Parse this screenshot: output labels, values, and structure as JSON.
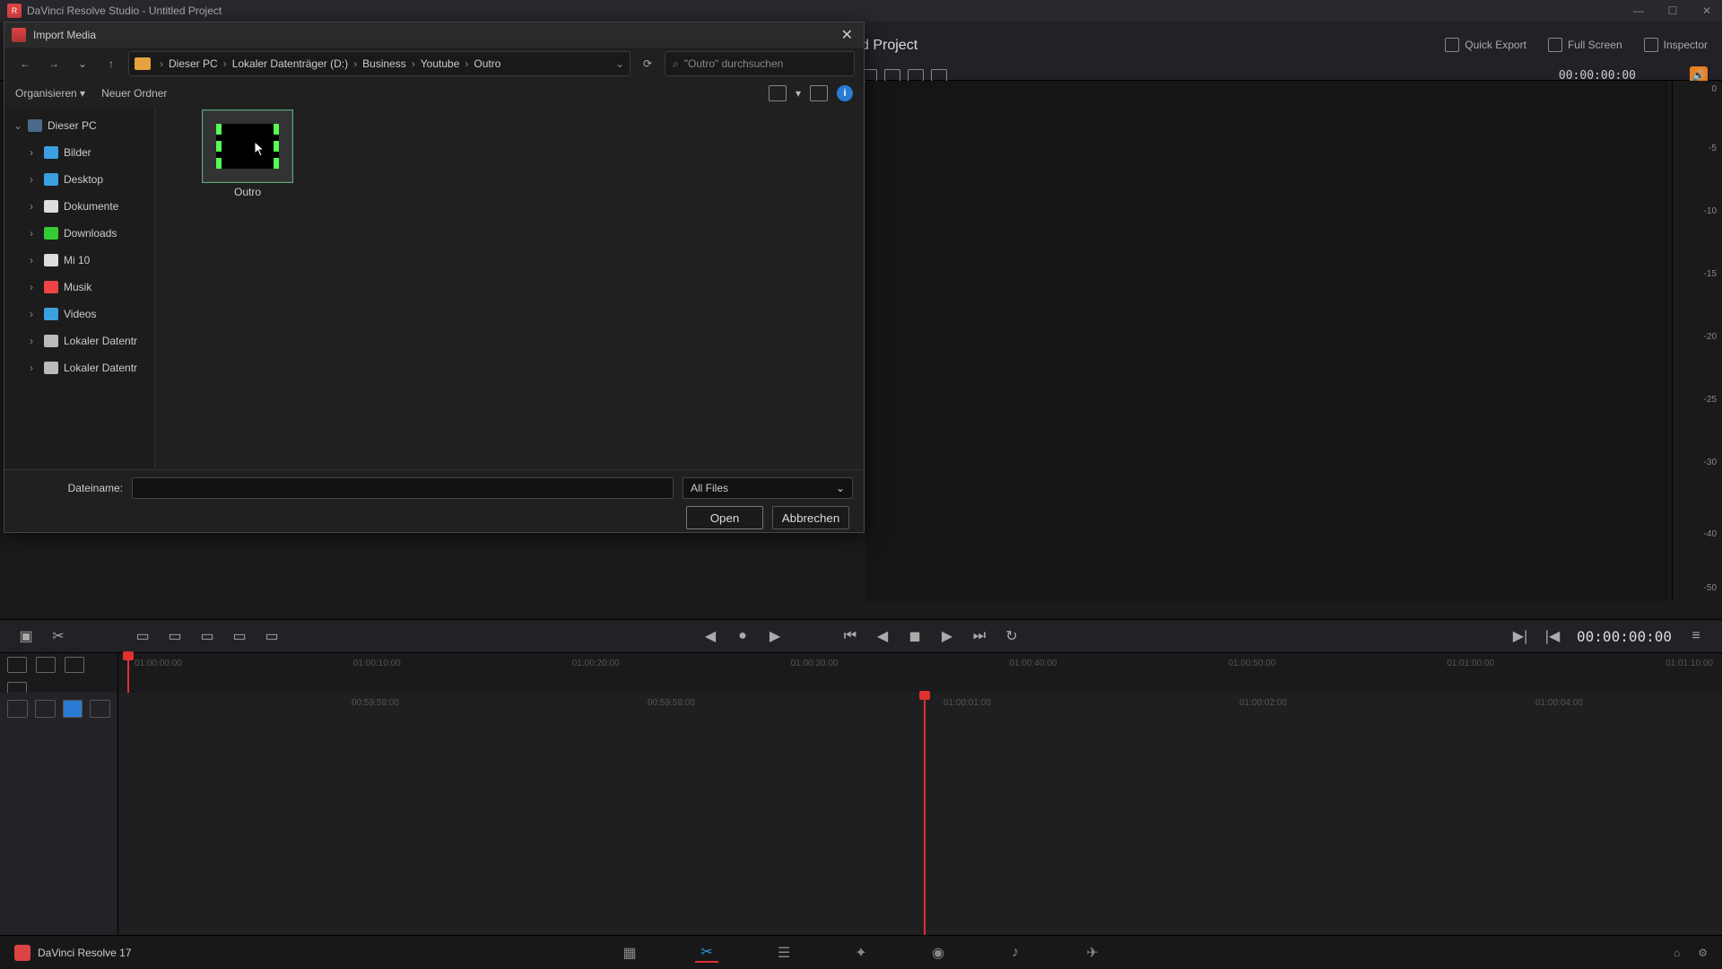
{
  "app": {
    "title": "DaVinci Resolve Studio - Untitled Project",
    "footer_name": "DaVinci Resolve 17"
  },
  "header": {
    "project_title": "d Project",
    "quick_export": "Quick Export",
    "full_screen": "Full Screen",
    "inspector": "Inspector",
    "timecode": "00:00:00:00"
  },
  "meters": {
    "m0": "0",
    "m5": "-5",
    "m10": "-10",
    "m15": "-15",
    "m20": "-20",
    "m25": "-25",
    "m30": "-30",
    "m40": "-40",
    "m50": "-50"
  },
  "transport": {
    "timecode": "00:00:00:00"
  },
  "ruler1_ticks": [
    "01:00:00:00",
    "01:00:10:00",
    "01:00:20:00",
    "01:00:30:00",
    "01:00:40:00",
    "01:00:50:00",
    "01:01:00:00",
    "01:01:10:00"
  ],
  "ruler2_ticks": [
    {
      "pos": 260,
      "label": "00:59:59:00"
    },
    {
      "pos": 590,
      "label": "00:59:59:00"
    },
    {
      "pos": 920,
      "label": "01:00:01:00"
    },
    {
      "pos": 1250,
      "label": "01:00:02:00"
    },
    {
      "pos": 1580,
      "label": "01:00:04:00"
    }
  ],
  "dialog": {
    "title": "Import Media",
    "organize": "Organisieren",
    "newfolder": "Neuer Ordner",
    "search_placeholder": "\"Outro\" durchsuchen",
    "path": [
      "Dieser PC",
      "Lokaler Datenträger (D:)",
      "Business",
      "Youtube",
      "Outro"
    ],
    "tree": [
      {
        "label": "Dieser PC",
        "cls": "ic-pc",
        "root": true
      },
      {
        "label": "Bilder",
        "cls": "ic-blue"
      },
      {
        "label": "Desktop",
        "cls": "ic-blue"
      },
      {
        "label": "Dokumente",
        "cls": "ic-doc"
      },
      {
        "label": "Downloads",
        "cls": "ic-dl"
      },
      {
        "label": "Mi 10",
        "cls": "ic-phone"
      },
      {
        "label": "Musik",
        "cls": "ic-music"
      },
      {
        "label": "Videos",
        "cls": "ic-vid"
      },
      {
        "label": "Lokaler Datentr",
        "cls": "ic-disk"
      },
      {
        "label": "Lokaler Datentr",
        "cls": "ic-disk"
      }
    ],
    "file": {
      "name": "Outro"
    },
    "filename_label": "Dateiname:",
    "filter": "All Files",
    "open": "Open",
    "cancel": "Abbrechen"
  }
}
